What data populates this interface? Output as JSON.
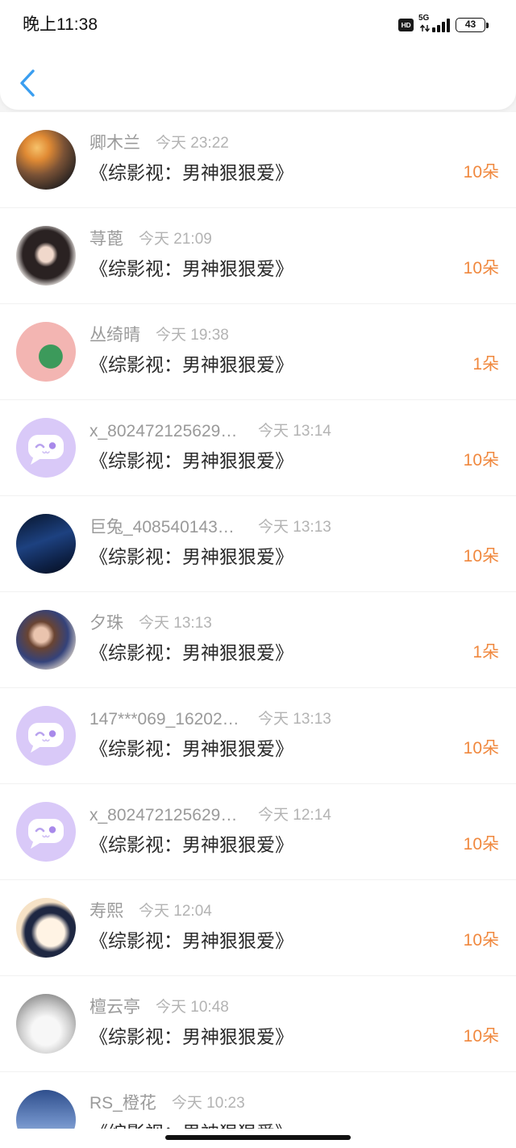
{
  "status_bar": {
    "time": "晚上11:38",
    "hd_label": "HD",
    "network": "5G",
    "battery": "43"
  },
  "header": {
    "back_icon": "chevron-left-icon"
  },
  "theme": {
    "accent": "#3a9ef0",
    "gift": "#f0883e",
    "name_gray": "#9a9a9a",
    "time_gray": "#b3b3b3",
    "default_avatar": "#d9c9f8"
  },
  "records": [
    {
      "name": "卿木兰",
      "time": "今天 23:22",
      "book": "《综影视：男神狠狠爱》",
      "gift": "10朵",
      "avatar_icon": "photo-avatar-icon"
    },
    {
      "name": "荨蓖",
      "time": "今天 21:09",
      "book": "《综影视：男神狠狠爱》",
      "gift": "10朵",
      "avatar_icon": "photo-avatar-icon"
    },
    {
      "name": "丛绮晴",
      "time": "今天 19:38",
      "book": "《综影视：男神狠狠爱》",
      "gift": "1朵",
      "avatar_icon": "photo-avatar-icon"
    },
    {
      "name": "x_802472125629…",
      "time": "今天 13:14",
      "book": "《综影视：男神狠狠爱》",
      "gift": "10朵",
      "avatar_icon": "default-chat-avatar-icon"
    },
    {
      "name": "巨兔_408540143…",
      "time": "今天 13:13",
      "book": "《综影视：男神狠狠爱》",
      "gift": "10朵",
      "avatar_icon": "photo-avatar-icon"
    },
    {
      "name": "夕珠",
      "time": "今天 13:13",
      "book": "《综影视：男神狠狠爱》",
      "gift": "1朵",
      "avatar_icon": "photo-avatar-icon"
    },
    {
      "name": "147***069_16202…",
      "time": "今天 13:13",
      "book": "《综影视：男神狠狠爱》",
      "gift": "10朵",
      "avatar_icon": "default-chat-avatar-icon"
    },
    {
      "name": "x_802472125629…",
      "time": "今天 12:14",
      "book": "《综影视：男神狠狠爱》",
      "gift": "10朵",
      "avatar_icon": "default-chat-avatar-icon"
    },
    {
      "name": "寿熙",
      "time": "今天 12:04",
      "book": "《综影视：男神狠狠爱》",
      "gift": "10朵",
      "avatar_icon": "photo-avatar-icon"
    },
    {
      "name": "檀云亭",
      "time": "今天 10:48",
      "book": "《综影视：男神狠狠爱》",
      "gift": "10朵",
      "avatar_icon": "photo-avatar-icon"
    },
    {
      "name": "RS_橙花",
      "time": "今天 10:23",
      "book": "《综影视：男神狠狠爱》",
      "avatar_icon": "photo-avatar-icon"
    }
  ]
}
